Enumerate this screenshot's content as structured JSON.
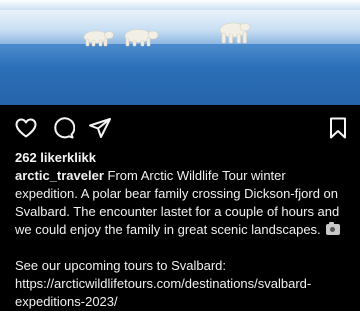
{
  "post": {
    "image_alt_icon": "polar-bears-photo",
    "likes": "262 likerklikk",
    "username": "arctic_traveler",
    "caption_text": "From Arctic Wildlife Tour winter expedition. A polar bear family crossing Dickson-fjord on Svalbard. The encounter lastet for a couple of hours and we could enjoy the family in great scenic landscapes.",
    "caption_emoji_icon": "camera-flash-icon",
    "link_text": "See our upcoming tours to Svalbard: https://arcticwildlifetours.com/destinations/svalbard-expeditions-2023/"
  },
  "actions": {
    "like_icon": "heart-icon",
    "comment_icon": "comment-icon",
    "share_icon": "share-icon",
    "save_icon": "bookmark-icon"
  },
  "colors": {
    "background": "#000000",
    "text": "#f5f5f5",
    "sky": "#2d6fb6"
  }
}
